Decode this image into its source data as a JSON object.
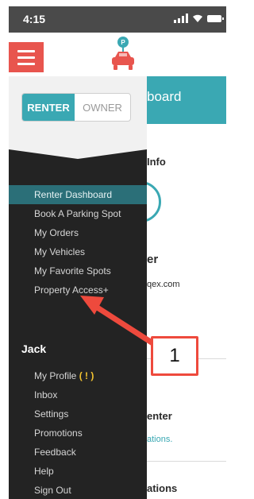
{
  "status_bar": {
    "time": "4:15"
  },
  "background_page": {
    "banner_title": "board",
    "section_1": "Info",
    "name_fragment": "er",
    "email_fragment": "qex.com",
    "section_2": "enter",
    "link_2": "ations.",
    "section_3": "ations"
  },
  "drawer": {
    "mode_toggle": {
      "renter": "RENTER",
      "owner": "OWNER"
    },
    "nav_items": [
      {
        "label": "Renter Dashboard",
        "active": true
      },
      {
        "label": "Book A Parking Spot"
      },
      {
        "label": "My Orders"
      },
      {
        "label": "My Vehicles"
      },
      {
        "label": "My Favorite Spots"
      },
      {
        "label": "Property Access+"
      }
    ],
    "user": {
      "name": "Jack",
      "items": [
        {
          "label": "My Profile",
          "badge": "( ! )"
        },
        {
          "label": "Inbox"
        },
        {
          "label": "Settings"
        },
        {
          "label": "Promotions"
        },
        {
          "label": "Feedback"
        },
        {
          "label": "Help"
        },
        {
          "label": "Sign Out"
        }
      ]
    }
  },
  "annotation": {
    "callout_number": "1"
  },
  "colors": {
    "accent_teal": "#3aa8b3",
    "menu_red": "#e8554e",
    "drawer_bg": "#232323",
    "arrow_red": "#ee4a3d"
  },
  "icons": [
    "menu-icon",
    "parking-car-logo-icon",
    "signal-icon",
    "wifi-icon",
    "battery-icon"
  ]
}
